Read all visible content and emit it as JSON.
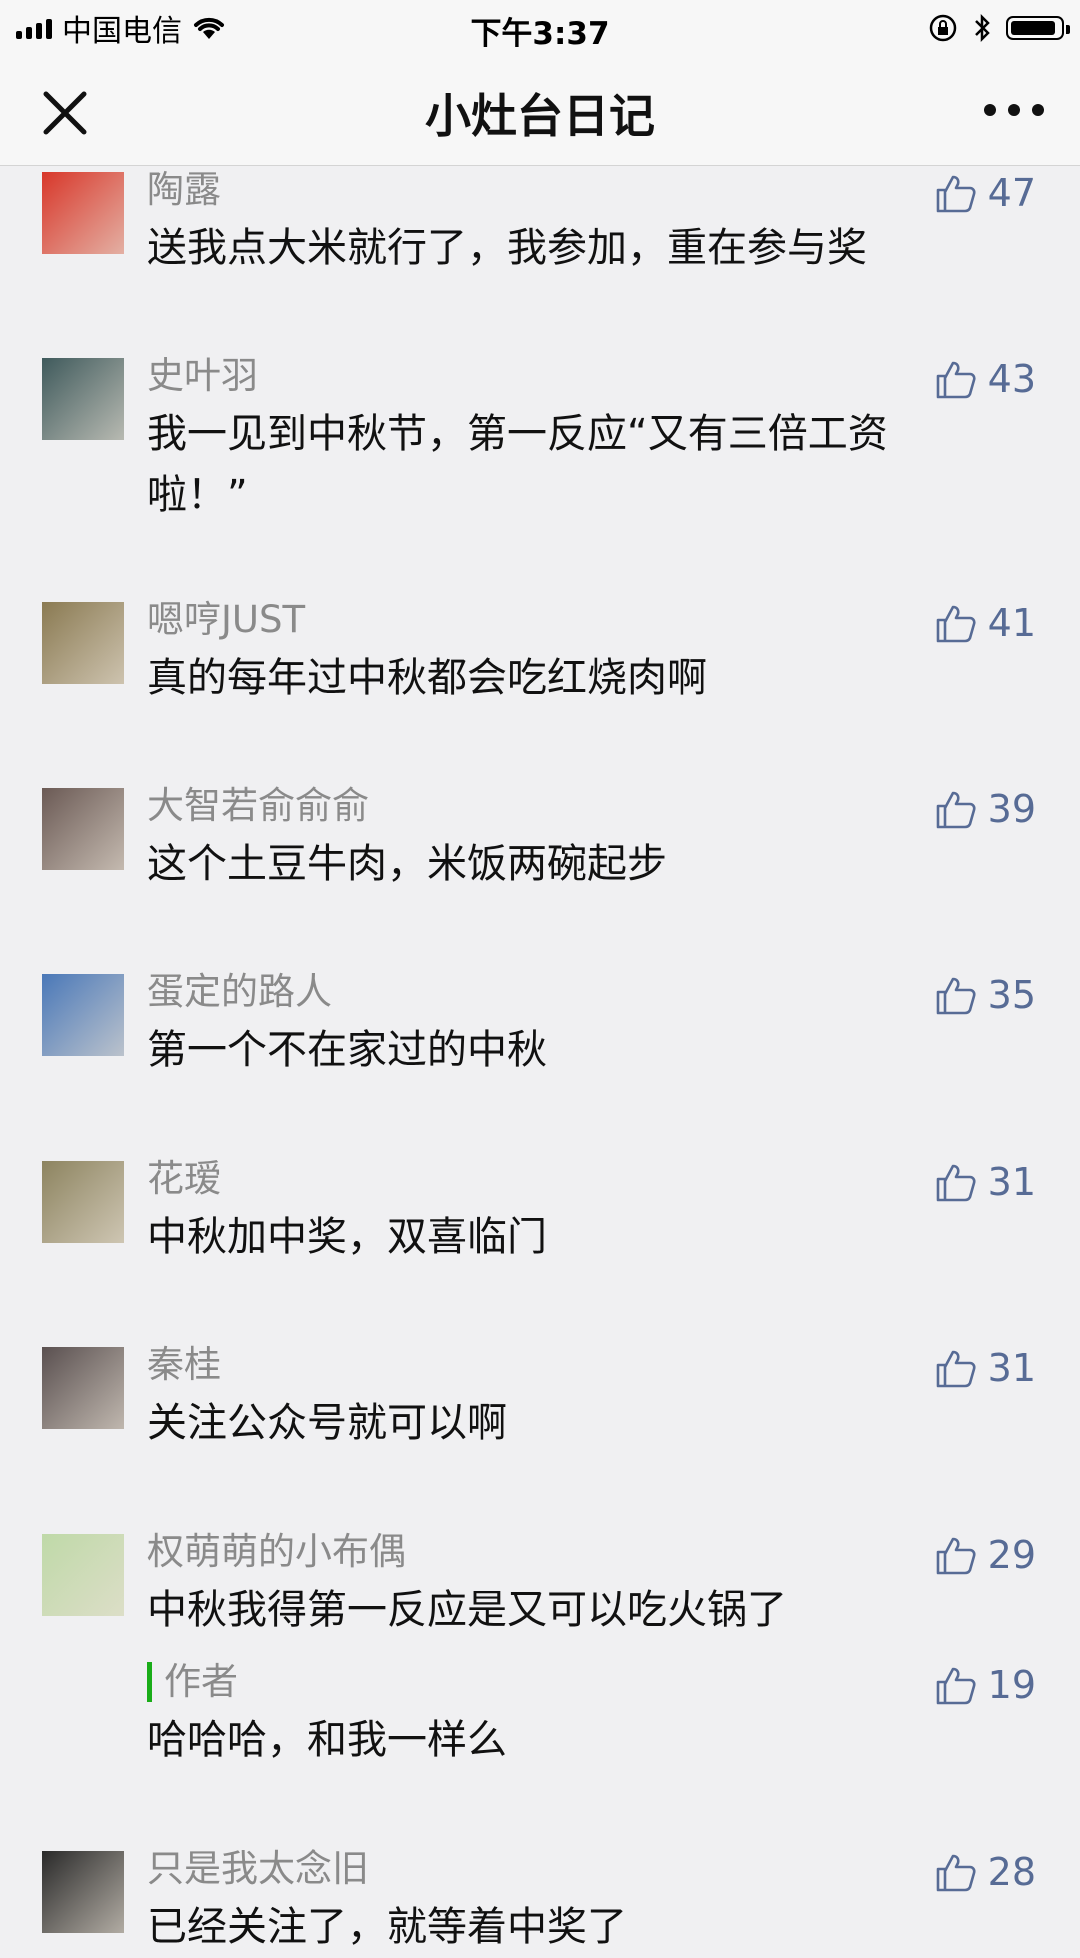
{
  "status_bar": {
    "carrier": "中国电信",
    "time": "下午3:37"
  },
  "nav": {
    "title": "小灶台日记"
  },
  "comments": [
    {
      "nickname": "陶露",
      "text": "送我点大米就行了，我参加，重在参与奖",
      "likes": "47",
      "avatar_color": "#d8372a"
    },
    {
      "nickname": "史叶羽",
      "text": "我一见到中秋节，第一反应“又有三倍工资啦！”",
      "likes": "43",
      "avatar_color": "#3f5a5c"
    },
    {
      "nickname": "嗯哼JUST",
      "text": "真的每年过中秋都会吃红烧肉啊",
      "likes": "41",
      "avatar_color": "#8a7a52"
    },
    {
      "nickname": "大智若俞俞俞",
      "text": "这个土豆牛肉，米饭两碗起步",
      "likes": "39",
      "avatar_color": "#6b5a55"
    },
    {
      "nickname": "蛋定的路人",
      "text": "第一个不在家过的中秋",
      "likes": "35",
      "avatar_color": "#4a78b8"
    },
    {
      "nickname": "花瑷",
      "text": "中秋加中奖，双喜临门",
      "likes": "31",
      "avatar_color": "#8d8460"
    },
    {
      "nickname": "秦桂",
      "text": "关注公众号就可以啊",
      "likes": "31",
      "avatar_color": "#5a5050"
    },
    {
      "nickname": "权萌萌的小布偶",
      "text": "中秋我得第一反应是又可以吃火锅了",
      "likes": "29",
      "avatar_color": "#bfd9a8",
      "reply": {
        "label": "作者",
        "text": "哈哈哈，和我一样么",
        "likes": "19"
      }
    },
    {
      "nickname": "只是我太念旧",
      "text": "已经关注了，就等着中奖了",
      "likes": "28",
      "avatar_color": "#2a2a2a"
    }
  ]
}
